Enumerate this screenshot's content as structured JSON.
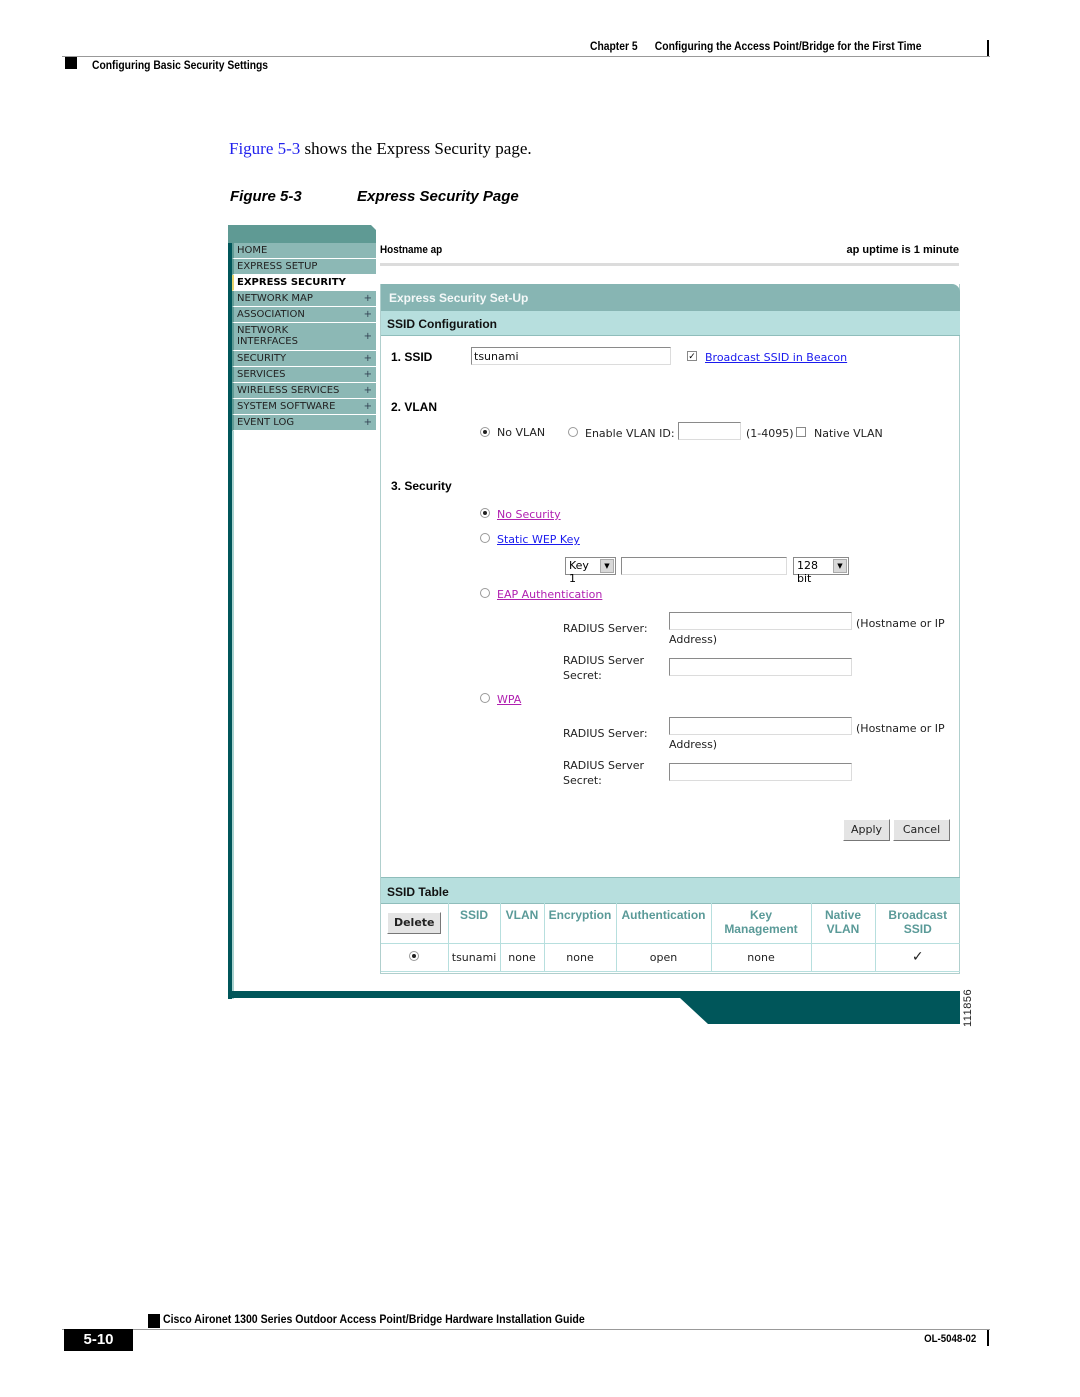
{
  "page_header": {
    "chapter_label": "Chapter 5",
    "chapter_title": "Configuring the Access Point/Bridge for the First Time",
    "section_title": "Configuring Basic Security Settings"
  },
  "intro": {
    "figure_ref": "Figure 5-3",
    "text": " shows the Express Security page."
  },
  "figure": {
    "number": "Figure 5-3",
    "title": "Express Security Page",
    "id_number": "111856"
  },
  "nav": {
    "items": [
      {
        "label": "HOME",
        "expandable": false
      },
      {
        "label": "EXPRESS SETUP",
        "expandable": false
      },
      {
        "label": "EXPRESS SECURITY",
        "expandable": false,
        "active": true
      },
      {
        "label": "NETWORK MAP",
        "expandable": true
      },
      {
        "label": "ASSOCIATION",
        "expandable": true
      },
      {
        "label": "NETWORK INTERFACES",
        "expandable": true
      },
      {
        "label": "SECURITY",
        "expandable": true
      },
      {
        "label": "SERVICES",
        "expandable": true
      },
      {
        "label": "WIRELESS SERVICES",
        "expandable": true
      },
      {
        "label": "SYSTEM SOFTWARE",
        "expandable": true
      },
      {
        "label": "EVENT LOG",
        "expandable": true
      }
    ],
    "expand_glyph": "+"
  },
  "status": {
    "hostname": "Hostname  ap",
    "uptime": "ap uptime is 1 minute"
  },
  "panel": {
    "title": "Express Security Set-Up",
    "ssid_config_title": "SSID Configuration",
    "ssid": {
      "label": "1. SSID",
      "value": "tsunami",
      "broadcast_checked": true,
      "broadcast_label": "Broadcast SSID in Beacon"
    },
    "vlan": {
      "label": "2. VLAN",
      "no_vlan_label": "No VLAN",
      "no_vlan_selected": true,
      "enable_label": "Enable VLAN ID:",
      "vlan_id_value": "",
      "range_hint": "(1-4095)",
      "native_label": "Native VLAN",
      "native_checked": false
    },
    "security": {
      "label": "3. Security",
      "no_security_label": "No Security",
      "no_security_selected": true,
      "static_wep_label": "Static WEP Key",
      "key_select_value": "Key 1",
      "key_value": "",
      "bit_select_value": "128 bit",
      "eap_label": "EAP Authentication",
      "eap_radius_server_label": "RADIUS Server:",
      "eap_radius_server_value": "",
      "eap_radius_hint_1": "(Hostname or IP",
      "eap_radius_hint_2": "Address)",
      "eap_radius_secret_label_1": "RADIUS Server",
      "eap_radius_secret_label_2": "Secret:",
      "eap_radius_secret_value": "",
      "wpa_label": "WPA",
      "wpa_radius_server_label": "RADIUS Server:",
      "wpa_radius_server_value": "",
      "wpa_radius_hint_1": "(Hostname or IP",
      "wpa_radius_hint_2": "Address)",
      "wpa_radius_secret_label_1": "RADIUS Server",
      "wpa_radius_secret_label_2": "Secret:",
      "wpa_radius_secret_value": ""
    },
    "buttons": {
      "apply": "Apply",
      "cancel": "Cancel"
    },
    "ssid_table": {
      "title": "SSID Table",
      "delete_label": "Delete",
      "headers": [
        "SSID",
        "VLAN",
        "Encryption",
        "Authentication",
        "Key Management",
        "Native VLAN",
        "Broadcast SSID"
      ],
      "header_lines": [
        [
          "SSID",
          ""
        ],
        [
          "VLAN",
          ""
        ],
        [
          "Encryption",
          ""
        ],
        [
          "Authentication",
          ""
        ],
        [
          "Key",
          "Management"
        ],
        [
          "Native",
          "VLAN"
        ],
        [
          "Broadcast",
          "SSID"
        ]
      ],
      "rows": [
        {
          "selected": true,
          "ssid": "tsunami",
          "vlan": "none",
          "encryption": "none",
          "authentication": "open",
          "key_management": "none",
          "native_vlan": "",
          "broadcast_ssid": "✓"
        }
      ]
    }
  },
  "page_footer": {
    "guide_title": "Cisco Aironet 1300 Series Outdoor Access Point/Bridge Hardware Installation Guide",
    "page_number": "5-10",
    "doc_number": "OL-5048-02"
  },
  "colors": {
    "teal_dark": "#00565a",
    "teal_mid": "#87b5b3",
    "teal_light": "#b7dfde",
    "link_blue": "#1a1aee",
    "link_visited": "#b01fb0"
  }
}
